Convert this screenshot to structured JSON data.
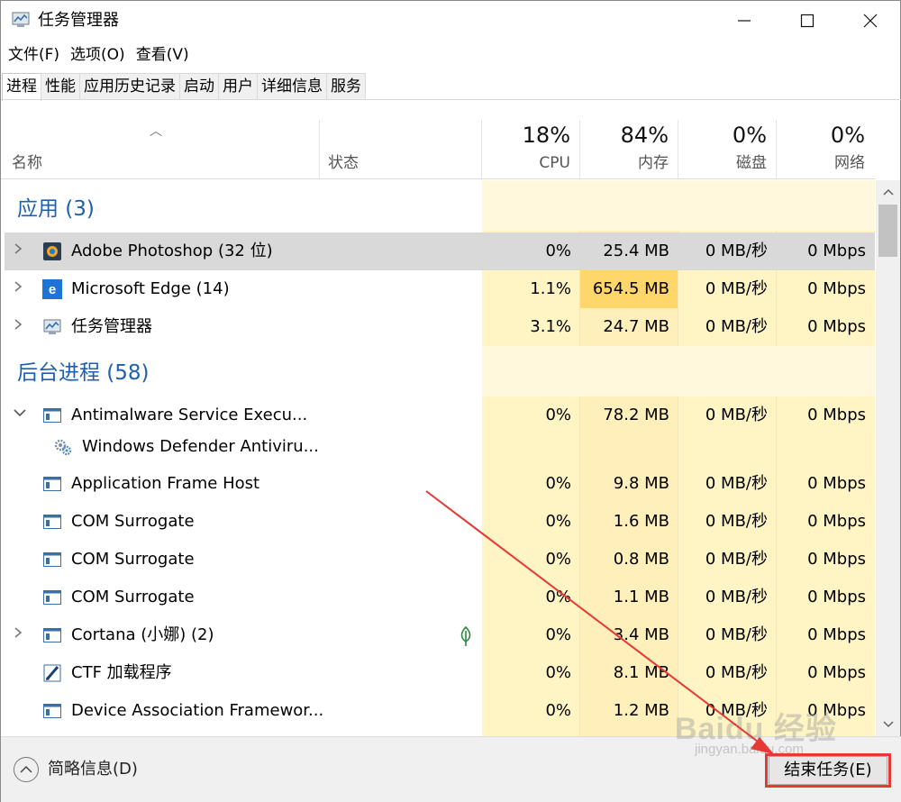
{
  "window": {
    "title": "任务管理器",
    "minimize": "—",
    "maximize": "☐",
    "close": "✕"
  },
  "menu": [
    "文件(F)",
    "选项(O)",
    "查看(V)"
  ],
  "tabs": [
    "进程",
    "性能",
    "应用历史记录",
    "启动",
    "用户",
    "详细信息",
    "服务"
  ],
  "active_tab": "进程",
  "columns": {
    "name": "名称",
    "status": "状态",
    "cpu_pct": "18%",
    "cpu": "CPU",
    "mem_pct": "84%",
    "mem": "内存",
    "disk_pct": "0%",
    "disk": "磁盘",
    "net_pct": "0%",
    "net": "网络"
  },
  "groups": {
    "apps": "应用 (3)",
    "background": "后台进程 (58)"
  },
  "apps": [
    {
      "name": "Adobe Photoshop (32 位)",
      "cpu": "0%",
      "mem": "25.4 MB",
      "disk": "0 MB/秒",
      "net": "0 Mbps",
      "icon": "photoshop-icon"
    },
    {
      "name": "Microsoft Edge (14)",
      "cpu": "1.1%",
      "mem": "654.5 MB",
      "disk": "0 MB/秒",
      "net": "0 Mbps",
      "icon": "edge-icon"
    },
    {
      "name": "任务管理器",
      "cpu": "3.1%",
      "mem": "24.7 MB",
      "disk": "0 MB/秒",
      "net": "0 Mbps",
      "icon": "task-manager-icon"
    }
  ],
  "background": [
    {
      "name": "Antimalware Service Execu...",
      "cpu": "0%",
      "mem": "78.2 MB",
      "disk": "0 MB/秒",
      "net": "0 Mbps",
      "icon": "window-icon"
    },
    {
      "name": "Windows Defender Antiviru...",
      "icon": "gears-icon"
    },
    {
      "name": "Application Frame Host",
      "cpu": "0%",
      "mem": "9.8 MB",
      "disk": "0 MB/秒",
      "net": "0 Mbps",
      "icon": "window-icon"
    },
    {
      "name": "COM Surrogate",
      "cpu": "0%",
      "mem": "1.6 MB",
      "disk": "0 MB/秒",
      "net": "0 Mbps",
      "icon": "window-icon"
    },
    {
      "name": "COM Surrogate",
      "cpu": "0%",
      "mem": "0.8 MB",
      "disk": "0 MB/秒",
      "net": "0 Mbps",
      "icon": "window-icon"
    },
    {
      "name": "COM Surrogate",
      "cpu": "0%",
      "mem": "1.1 MB",
      "disk": "0 MB/秒",
      "net": "0 Mbps",
      "icon": "window-icon"
    },
    {
      "name": "Cortana (小娜) (2)",
      "cpu": "0%",
      "mem": "3.4 MB",
      "disk": "0 MB/秒",
      "net": "0 Mbps",
      "icon": "window-icon"
    },
    {
      "name": "CTF 加载程序",
      "cpu": "0%",
      "mem": "8.1 MB",
      "disk": "0 MB/秒",
      "net": "0 Mbps",
      "icon": "pen-icon"
    },
    {
      "name": "Device Association Framewor...",
      "cpu": "0%",
      "mem": "1.2 MB",
      "disk": "0 MB/秒",
      "net": "0 Mbps",
      "icon": "window-icon"
    }
  ],
  "footer": {
    "fewer_details": "简略信息(D)",
    "end_task": "结束任务(E)"
  },
  "watermark": {
    "main": "Baidu 经验",
    "sub": "jingyan.baidu.com"
  },
  "colors": {
    "heat_light": "#fff4c4",
    "heat_high": "#ffd66a",
    "group_label": "#1e5fb4",
    "annotation": "#e53935"
  }
}
